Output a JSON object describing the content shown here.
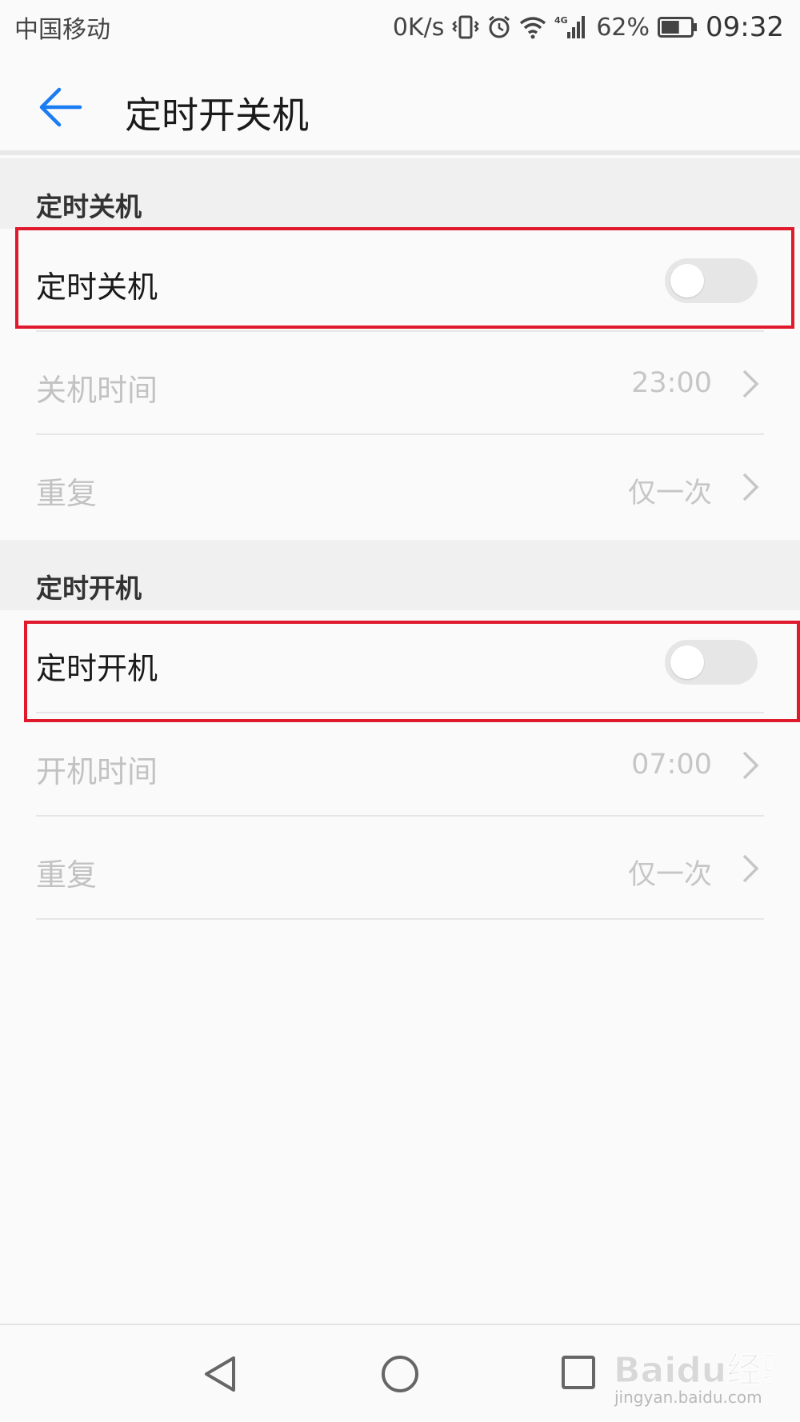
{
  "status_bar": {
    "carrier": "中国移动",
    "network_speed": "0K/s",
    "network_type": "4G",
    "battery_percent": "62%",
    "battery_level": 0.62,
    "time": "09:32",
    "icons": [
      "vibrate-icon",
      "alarm-icon",
      "wifi-icon",
      "signal-icon",
      "battery-icon"
    ]
  },
  "header": {
    "back_icon": "arrow-left-icon",
    "title": "定时开关机",
    "accent_color": "#1a7cf3"
  },
  "shutdown_section": {
    "header": "定时关机",
    "toggle_label": "定时关机",
    "toggle_on": false,
    "time_label": "关机时间",
    "time_value": "23:00",
    "repeat_label": "重复",
    "repeat_value": "仅一次"
  },
  "startup_section": {
    "header": "定时开机",
    "toggle_label": "定时开机",
    "toggle_on": false,
    "time_label": "开机时间",
    "time_value": "07:00",
    "repeat_label": "重复",
    "repeat_value": "仅一次"
  },
  "annotations": {
    "highlight_color": "#e0192c"
  },
  "nav_bar": {
    "buttons": [
      "back-triangle-icon",
      "home-circle-icon",
      "recents-square-icon"
    ]
  },
  "watermark": {
    "brand": "Baidu经验",
    "url": "jingyan.baidu.com"
  }
}
